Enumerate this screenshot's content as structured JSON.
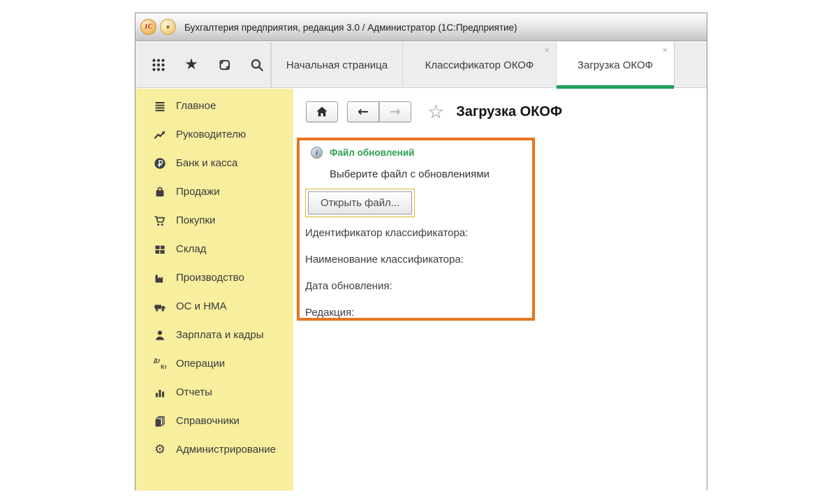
{
  "titlebar": {
    "logo_text": "1С",
    "menu_glyph": "▼",
    "title": "Бухгалтерия предприятия, редакция 3.0 / Администратор  (1С:Предприятие)"
  },
  "ui": {
    "close_glyph": "×",
    "star_filled_glyph": "★",
    "star_outline_glyph": "☆",
    "back_glyph": "←",
    "forward_glyph": "→",
    "gear_glyph": "⚙"
  },
  "toolbar": {
    "icons": [
      {
        "name": "apps-grid-icon"
      },
      {
        "name": "favorites-star-icon"
      },
      {
        "name": "history-scroll-icon"
      },
      {
        "name": "search-icon"
      }
    ]
  },
  "tabs": [
    {
      "label": "Начальная страница",
      "closable": false,
      "active": false
    },
    {
      "label": "Классификатор ОКОФ",
      "closable": true,
      "active": false
    },
    {
      "label": "Загрузка ОКОФ",
      "closable": true,
      "active": true
    }
  ],
  "sidebar": {
    "items": [
      {
        "label": "Главное",
        "icon": "main-menu-icon"
      },
      {
        "label": "Руководителю",
        "icon": "manager-trend-icon"
      },
      {
        "label": "Банк и касса",
        "icon": "bank-ruble-icon"
      },
      {
        "label": "Продажи",
        "icon": "sales-bag-icon"
      },
      {
        "label": "Покупки",
        "icon": "purchases-cart-icon"
      },
      {
        "label": "Склад",
        "icon": "warehouse-boxes-icon"
      },
      {
        "label": "Производство",
        "icon": "production-factory-icon"
      },
      {
        "label": "ОС и НМА",
        "icon": "fixed-assets-truck-icon"
      },
      {
        "label": "Зарплата и кадры",
        "icon": "hr-person-icon"
      },
      {
        "label": "Операции",
        "icon": "operations-dtkt-icon",
        "dt": "Дт",
        "kt": "Кт"
      },
      {
        "label": "Отчеты",
        "icon": "reports-chart-icon"
      },
      {
        "label": "Справочники",
        "icon": "catalogs-books-icon"
      },
      {
        "label": "Администрирование",
        "icon": "admin-gear-icon"
      }
    ]
  },
  "content": {
    "page_title": "Загрузка ОКОФ",
    "panel": {
      "header": "Файл обновлений",
      "info_glyph": "i",
      "prompt": "Выберите файл с обновлениями",
      "open_button": "Открыть файл...",
      "fields": [
        "Идентификатор классификатора:",
        "Наименование классификатора:",
        "Дата обновления:",
        "Редакция:"
      ]
    }
  },
  "colors": {
    "accent_green": "#1ca05a",
    "panel_border_orange": "#e8741d",
    "sidebar_yellow": "#f7ee9e",
    "focus_ring_gold": "#d8b832",
    "header_text_green": "#2f9e50"
  }
}
